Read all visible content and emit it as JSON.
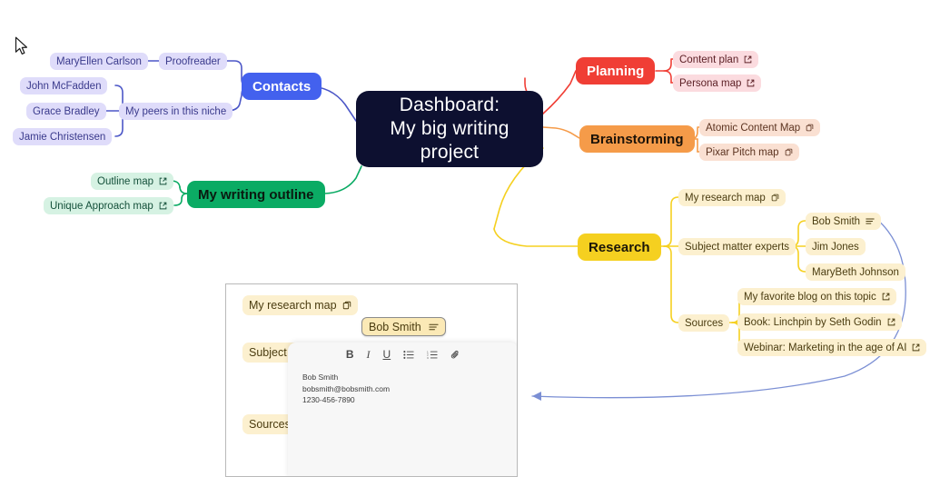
{
  "central": {
    "line1": "Dashboard:",
    "line2": "My big writing",
    "line3": "project",
    "color": "#0d1030"
  },
  "branches": {
    "contacts": {
      "label": "Contacts",
      "color": "#4361ee"
    },
    "outline": {
      "label": "My writing outline",
      "color": "#0bab64"
    },
    "planning": {
      "label": "Planning",
      "color": "#f03e35"
    },
    "brainstorming": {
      "label": "Brainstorming",
      "color": "#f59b49"
    },
    "research": {
      "label": "Research",
      "color": "#f5d020"
    }
  },
  "contacts_children": [
    {
      "label": "MaryEllen Carlson",
      "icon": "none"
    },
    {
      "label": "Proofreader",
      "icon": "none"
    },
    {
      "label": "John McFadden",
      "icon": "none"
    },
    {
      "label": "Grace Bradley",
      "icon": "none"
    },
    {
      "label": "Jamie Christensen",
      "icon": "none"
    },
    {
      "label": "My peers in this niche",
      "icon": "none"
    }
  ],
  "outline_children": [
    {
      "label": "Outline map",
      "icon": "external-link-icon"
    },
    {
      "label": "Unique Approach map",
      "icon": "external-link-icon"
    }
  ],
  "planning_children": [
    {
      "label": "Content plan",
      "icon": "external-link-icon"
    },
    {
      "label": "Persona map",
      "icon": "external-link-icon"
    }
  ],
  "brainstorming_children": [
    {
      "label": "Atomic Content Map",
      "icon": "copy-icon"
    },
    {
      "label": "Pixar Pitch map",
      "icon": "copy-icon"
    }
  ],
  "research_children": [
    {
      "label": "My research map",
      "icon": "copy-icon"
    },
    {
      "label": "Subject matter experts",
      "icon": "none"
    },
    {
      "label": "Sources",
      "icon": "none"
    }
  ],
  "experts": [
    {
      "label": "Bob Smith",
      "icon": "note-icon"
    },
    {
      "label": "Jim Jones",
      "icon": "none"
    },
    {
      "label": "MaryBeth Johnson",
      "icon": "none"
    }
  ],
  "sources": [
    {
      "label": "My favorite blog on this topic",
      "icon": "external-link-icon"
    },
    {
      "label": "Book: Linchpin by Seth Godin",
      "icon": "external-link-icon"
    },
    {
      "label": "Webinar: Marketing in the age of AI",
      "icon": "external-link-icon"
    }
  ],
  "detail_panel": {
    "research_map": {
      "label": "My research map",
      "icon": "copy-icon"
    },
    "subject_matter": {
      "label": "Subject m"
    },
    "sources": {
      "label": "Sources"
    },
    "selected_chip": {
      "label": "Bob Smith",
      "icon": "note-icon"
    },
    "toolbar": [
      {
        "name": "bold-button",
        "glyph": "B"
      },
      {
        "name": "italic-button",
        "glyph": "I"
      },
      {
        "name": "underline-button",
        "glyph": "U"
      },
      {
        "name": "bulleted-list-button",
        "glyph": "list-bulleted-icon"
      },
      {
        "name": "numbered-list-button",
        "glyph": "list-numbered-icon"
      },
      {
        "name": "attachment-button",
        "glyph": "paperclip-icon"
      }
    ],
    "note_lines": [
      "Bob Smith",
      "bobsmith@bobsmith.com",
      "1230-456-7890"
    ]
  },
  "colors": {
    "canvas": "#ffffff",
    "connector_indigo": "#4c57c7",
    "connector_green": "#0bab64",
    "connector_red": "#f03e35",
    "connector_orange": "#f59b49",
    "connector_yellow": "#f5d020",
    "callout_blue": "#7b8fd4"
  }
}
